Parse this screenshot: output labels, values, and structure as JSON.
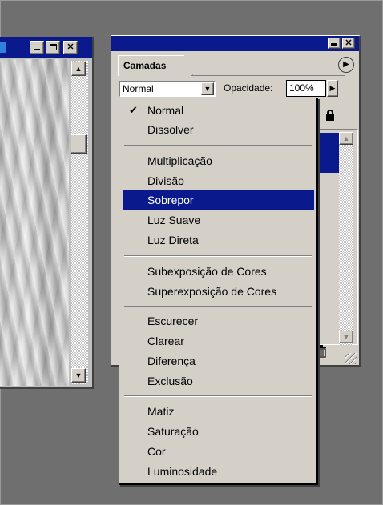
{
  "image_window": {
    "title_buttons": [
      "minimize",
      "maximize",
      "close"
    ]
  },
  "layers_palette": {
    "tab_label": "Camadas",
    "blend_mode_value": "Normal",
    "opacity_label": "Opacidade:",
    "opacity_value": "100%"
  },
  "blend_menu": {
    "items": [
      {
        "label": "Normal",
        "checked": true
      },
      {
        "label": "Dissolver"
      },
      {
        "label": "Multiplicação"
      },
      {
        "label": "Divisão"
      },
      {
        "label": "Sobrepor",
        "highlighted": true
      },
      {
        "label": "Luz Suave"
      },
      {
        "label": "Luz Direta"
      },
      {
        "label": "Subexposição de Cores"
      },
      {
        "label": "Superexposição de Cores"
      },
      {
        "label": "Escurecer"
      },
      {
        "label": "Clarear"
      },
      {
        "label": "Diferença"
      },
      {
        "label": "Exclusão"
      },
      {
        "label": "Matiz"
      },
      {
        "label": "Saturação"
      },
      {
        "label": "Cor"
      },
      {
        "label": "Luminosidade"
      }
    ]
  },
  "colors": {
    "title_bar": "#0a1a8c",
    "highlight": "#0a1a8c",
    "face": "#d4d0c8",
    "desktop": "#6f6f6f"
  },
  "icons": [
    "minimize-icon",
    "maximize-icon",
    "close-icon",
    "scroll-up-icon",
    "scroll-down-icon",
    "palette-menu-arrow-icon",
    "dropdown-arrow-icon",
    "lock-icon",
    "trash-icon",
    "resize-grip-icon",
    "checkmark-icon"
  ]
}
